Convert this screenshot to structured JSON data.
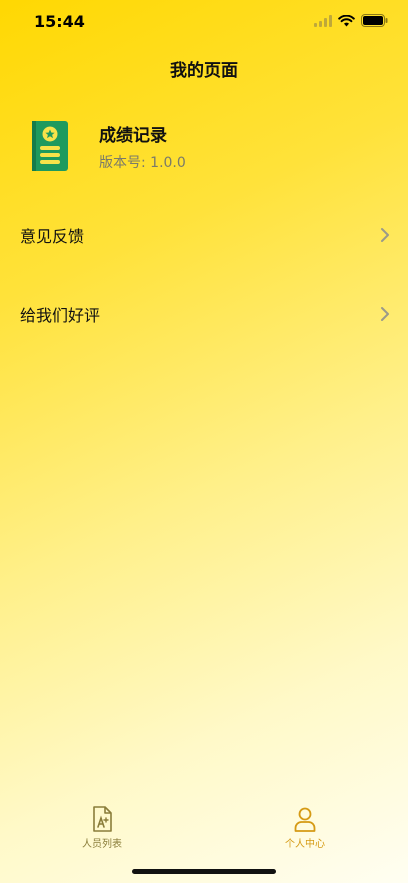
{
  "status_bar": {
    "time": "15:44",
    "icons": [
      "signal-icon",
      "wifi-icon",
      "battery-icon"
    ]
  },
  "header": {
    "title": "我的页面"
  },
  "app_info": {
    "icon": "notebook-icon",
    "name": "成绩记录",
    "version": "版本号: 1.0.0"
  },
  "menu": {
    "items": [
      {
        "label": "意见反馈",
        "icon": "chevron-right-icon"
      },
      {
        "label": "给我们好评",
        "icon": "chevron-right-icon"
      }
    ]
  },
  "tab_bar": {
    "tabs": [
      {
        "label": "人员列表",
        "icon": "document-person-icon",
        "active": false
      },
      {
        "label": "个人中心",
        "icon": "user-icon",
        "active": true
      }
    ]
  },
  "colors": {
    "background_start": "#ffd802",
    "background_end": "#fffef2",
    "icon_green": "#1e9a5e",
    "icon_yellow": "#f7e34a",
    "tab_active": "#d59a14",
    "tab_inactive": "#8a7d3a"
  }
}
